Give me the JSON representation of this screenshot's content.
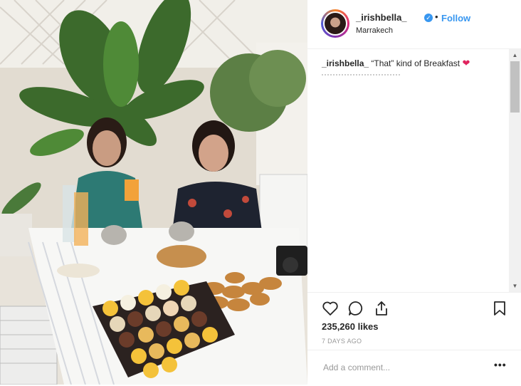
{
  "post": {
    "username": "_irishbella_",
    "verified_mark": "✓",
    "separator": "•",
    "follow_label": "Follow",
    "location": "Marrakech",
    "caption_user": "_irishbella_",
    "caption_text": " “That” kind of Breakfast ",
    "caption_emoji": "❤",
    "likes": "235,260 likes",
    "time_ago": "7 DAYS AGO",
    "comment_placeholder": "Add a comment...",
    "more_label": "•••",
    "scroll_up": "▲",
    "scroll_down": "▼"
  },
  "icons": [
    "heart-icon",
    "comment-icon",
    "share-icon",
    "bookmark-icon",
    "verified-icon",
    "more-options-icon"
  ],
  "colors": {
    "accent": "#3897f0",
    "text": "#262626",
    "muted": "#999999",
    "heart": "#e0245e"
  }
}
